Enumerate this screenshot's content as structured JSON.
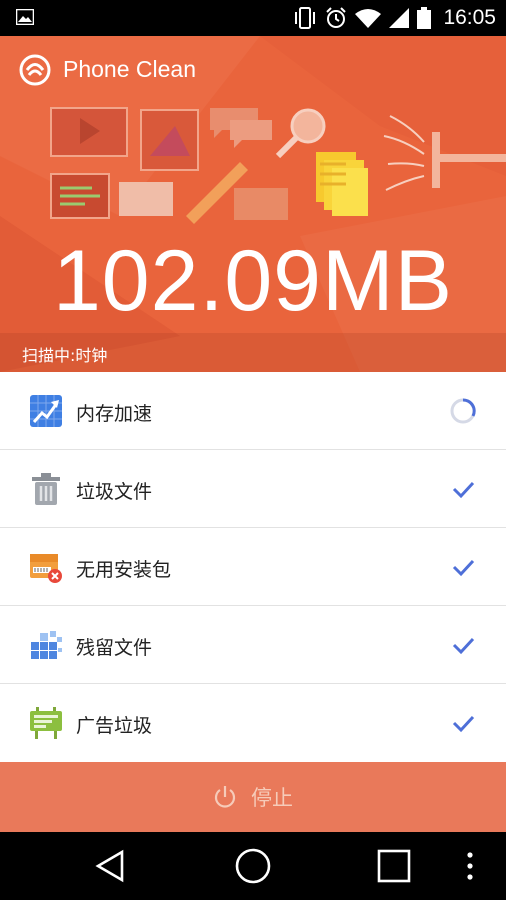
{
  "status_bar": {
    "time": "16:05",
    "icons": [
      "image-icon",
      "vibrate-icon",
      "alarm-icon",
      "wifi-icon",
      "signal-icon",
      "battery-icon"
    ]
  },
  "header": {
    "app_title": "Phone Clean",
    "size": "102.09MB",
    "scan_status": "扫描中:时钟"
  },
  "items": [
    {
      "label": "内存加速",
      "icon": "memory-boost-icon",
      "status": "loading"
    },
    {
      "label": "垃圾文件",
      "icon": "trash-icon",
      "status": "done"
    },
    {
      "label": "无用安装包",
      "icon": "apk-package-icon",
      "status": "done"
    },
    {
      "label": "残留文件",
      "icon": "residual-files-icon",
      "status": "done"
    },
    {
      "label": "广告垃圾",
      "icon": "ad-junk-icon",
      "status": "done"
    }
  ],
  "stop_button": {
    "label": "停止",
    "icon": "power-icon"
  },
  "nav": [
    "back-icon",
    "home-icon",
    "recents-icon",
    "menu-icon"
  ],
  "colors": {
    "accent": "#E9643C",
    "stop_button": "#E9795A",
    "check": "#4E6FD8"
  }
}
